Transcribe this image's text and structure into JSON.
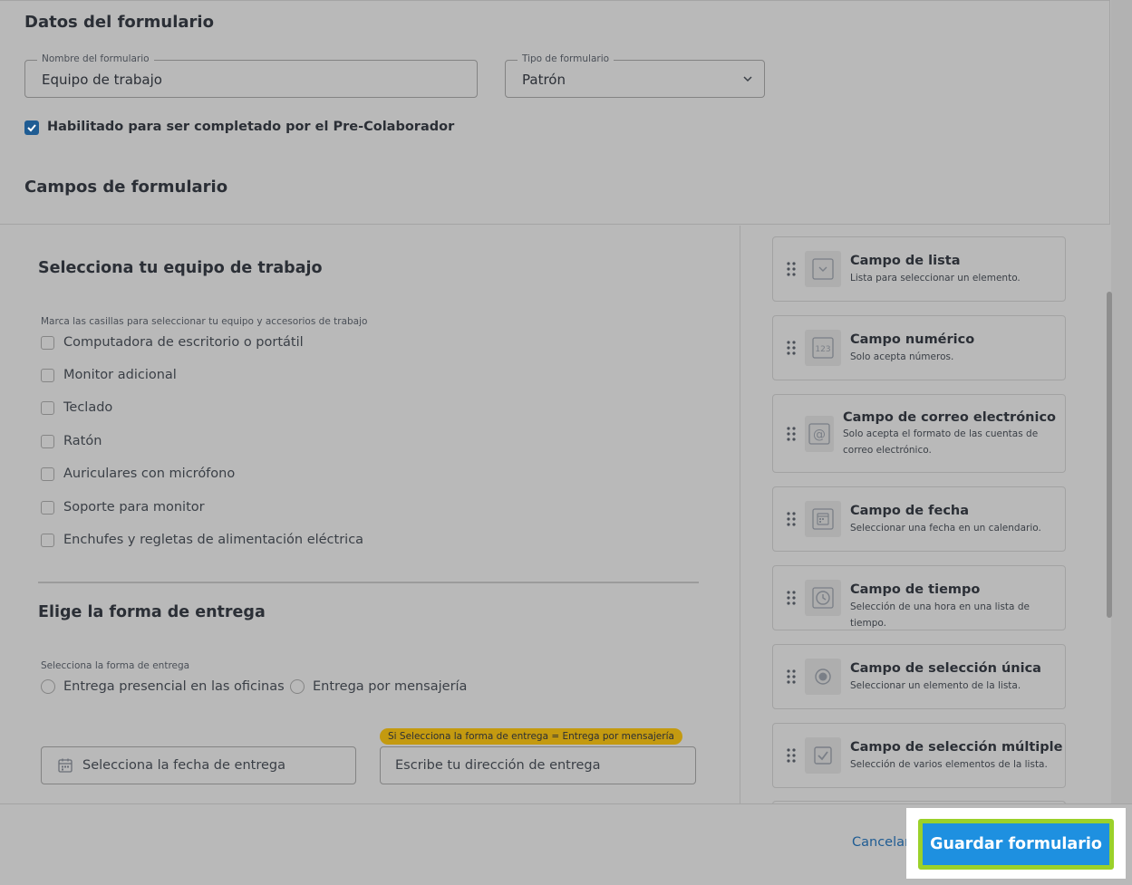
{
  "form_data": {
    "title": "Datos del formulario",
    "name_field": {
      "label": "Nombre del formulario",
      "value": "Equipo de trabajo"
    },
    "type_field": {
      "label": "Tipo de formulario",
      "value": "Patrón"
    },
    "precollab_checkbox": {
      "label": "Habilitado para ser completado por el Pre-Colaborador",
      "checked": true
    }
  },
  "fields_section": {
    "title": "Campos de formulario"
  },
  "equipment": {
    "title": "Selecciona tu equipo de trabajo",
    "instruction": "Marca las casillas para seleccionar tu equipo y accesorios de trabajo",
    "options": [
      "Computadora de escritorio o portátil",
      "Monitor adicional",
      "Teclado",
      "Ratón",
      "Auriculares con micrófono",
      "Soporte para monitor",
      "Enchufes y regletas de alimentación eléctrica"
    ]
  },
  "delivery": {
    "title": "Elige la forma de entrega",
    "instruction": "Selecciona la forma de entrega",
    "options": [
      "Entrega presencial en las oficinas",
      "Entrega por mensajería"
    ],
    "date_placeholder": "Selecciona la fecha de entrega",
    "condition_tag": "Si Selecciona la forma de entrega = Entrega por mensajería",
    "address_placeholder": "Escribe tu dirección de entrega"
  },
  "field_types": [
    {
      "title": "Campo de lista",
      "desc": "Lista para seleccionar un elemento.",
      "icon": "list-dropdown-icon"
    },
    {
      "title": "Campo numérico",
      "desc": "Solo acepta números.",
      "icon": "number-123-icon",
      "icon_text": "123"
    },
    {
      "title": "Campo de correo electrónico",
      "desc": "Solo acepta el formato de las cuentas de correo electrónico.",
      "icon": "at-sign-icon"
    },
    {
      "title": "Campo de fecha",
      "desc": "Seleccionar una fecha en un calendario.",
      "icon": "calendar-icon"
    },
    {
      "title": "Campo de tiempo",
      "desc": "Selección de una hora en una lista de tiempo.",
      "icon": "clock-icon"
    },
    {
      "title": "Campo de selección única",
      "desc": "Seleccionar un elemento de la lista.",
      "icon": "radio-icon"
    },
    {
      "title": "Campo de selección múltiple",
      "desc": "Selección de varios elementos de la lista.",
      "icon": "checkbox-icon"
    }
  ],
  "footer": {
    "cancel_label": "Cancelar",
    "save_label": "Guardar formulario"
  },
  "colors": {
    "accent": "#1e90e0",
    "highlight": "#9bd12a",
    "condition_tag": "#c49a10",
    "link": "#1f5c93"
  }
}
